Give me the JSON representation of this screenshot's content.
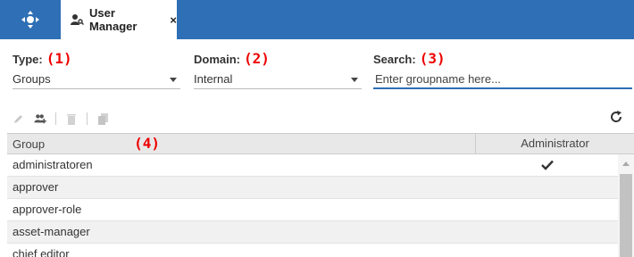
{
  "header": {
    "nav_icon": "move-arrows-icon",
    "tab": {
      "label": "User Manager",
      "close_label": "×",
      "icon": "user-key-icon"
    }
  },
  "filters": {
    "type": {
      "label": "Type:",
      "marker": "(1)",
      "value": "Groups"
    },
    "domain": {
      "label": "Domain:",
      "marker": "(2)",
      "value": "Internal"
    },
    "search": {
      "label": "Search:",
      "marker": "(3)",
      "placeholder": "Enter groupname here..."
    }
  },
  "toolbar": {
    "icons": [
      "pencil-icon",
      "add-group-icon",
      "trash-icon",
      "copy-icon"
    ],
    "refresh_icon": "refresh-icon"
  },
  "table": {
    "columns": [
      "Group",
      "Administrator"
    ],
    "marker": "(4)",
    "rows": [
      {
        "name": "administratoren",
        "admin": true
      },
      {
        "name": "approver",
        "admin": false
      },
      {
        "name": "approver-role",
        "admin": false
      },
      {
        "name": "asset-manager",
        "admin": false
      },
      {
        "name": "chief editor",
        "admin": false
      }
    ]
  },
  "colors": {
    "header_bg": "#2e6fb5",
    "marker": "#e00000",
    "accent": "#2e6fb5"
  }
}
